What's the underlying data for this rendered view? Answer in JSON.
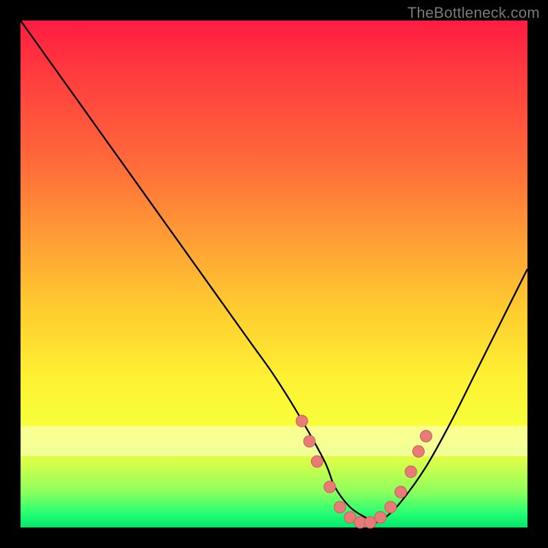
{
  "attribution": "TheBottleneck.com",
  "colors": {
    "page_bg": "#000000",
    "text": "#7a7a7a",
    "gradient_top": "#ff1b42",
    "gradient_mid1": "#ff9a36",
    "gradient_mid2": "#fef032",
    "gradient_bottom": "#00e86c",
    "curve": "#000000",
    "marker_fill": "#e87b78",
    "marker_stroke": "#c95a57"
  },
  "chart_data": {
    "type": "line",
    "title": "",
    "xlabel": "",
    "ylabel": "",
    "xlim": [
      0,
      100
    ],
    "ylim": [
      0,
      100
    ],
    "grid": false,
    "legend": false,
    "series": [
      {
        "name": "bottleneck-curve",
        "x": [
          0,
          5,
          10,
          15,
          20,
          25,
          30,
          35,
          40,
          45,
          50,
          55,
          60,
          62,
          65,
          68,
          70,
          72,
          75,
          80,
          85,
          90,
          95,
          100
        ],
        "y": [
          100,
          93,
          86,
          79,
          72,
          65,
          58,
          51,
          44,
          37,
          30,
          22,
          13,
          8,
          4,
          2,
          1,
          2,
          5,
          12,
          21,
          31,
          41,
          51
        ]
      }
    ],
    "markers": [
      {
        "x": 55.5,
        "y": 21
      },
      {
        "x": 57.0,
        "y": 17
      },
      {
        "x": 58.5,
        "y": 13
      },
      {
        "x": 61.0,
        "y": 8
      },
      {
        "x": 63.0,
        "y": 4
      },
      {
        "x": 65.0,
        "y": 2
      },
      {
        "x": 67.0,
        "y": 1
      },
      {
        "x": 69.0,
        "y": 1
      },
      {
        "x": 71.0,
        "y": 2
      },
      {
        "x": 73.0,
        "y": 4
      },
      {
        "x": 75.0,
        "y": 7
      },
      {
        "x": 77.0,
        "y": 11
      },
      {
        "x": 78.5,
        "y": 15
      },
      {
        "x": 80.0,
        "y": 18
      }
    ],
    "band": {
      "y_from": 14,
      "y_to": 20
    }
  }
}
